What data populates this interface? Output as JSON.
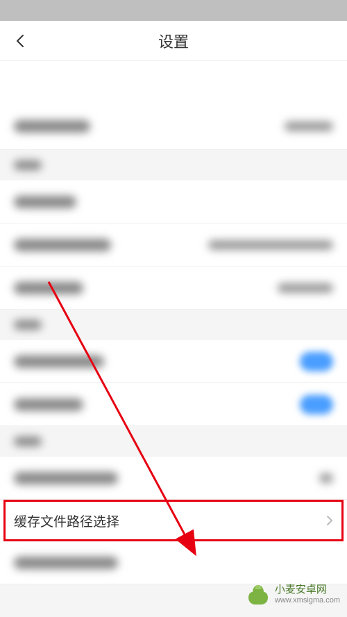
{
  "header": {
    "title": "设置"
  },
  "highlighted_row": {
    "label": "缓存文件路径选择"
  },
  "watermark": {
    "title": "小麦安卓网",
    "url": "www.xmsigma.com"
  },
  "colors": {
    "highlight": "#e60012",
    "toggle_on": "#4a9eff",
    "arrow": "#e60012"
  }
}
